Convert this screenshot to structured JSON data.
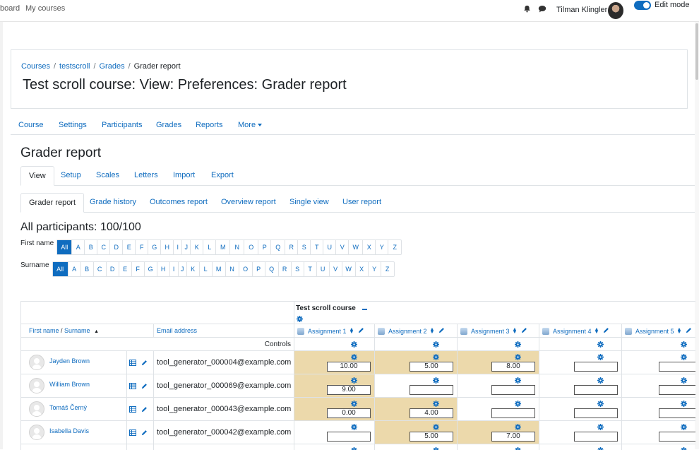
{
  "topbar": {
    "nav": [
      "board",
      "My courses"
    ],
    "user_name": "Tilman Klingler",
    "edit_mode_label": "Edit mode"
  },
  "breadcrumb": [
    "Courses",
    "testscroll",
    "Grades",
    "Grader report"
  ],
  "page_title": "Test scroll course: View: Preferences: Grader report",
  "course_nav": [
    "Course",
    "Settings",
    "Participants",
    "Grades",
    "Reports",
    "More"
  ],
  "main_heading": "Grader report",
  "tabs_primary": [
    "View",
    "Setup",
    "Scales",
    "Letters",
    "Import",
    "Export"
  ],
  "tabs_secondary": [
    "Grader report",
    "Grade history",
    "Outcomes report",
    "Overview report",
    "Single view",
    "User report"
  ],
  "participants_heading": "All participants: 100/100",
  "initials": {
    "firstname_label": "First name",
    "surname_label": "Surname",
    "all_label": "All",
    "letters": [
      "A",
      "B",
      "C",
      "D",
      "E",
      "F",
      "G",
      "H",
      "I",
      "J",
      "K",
      "L",
      "M",
      "N",
      "O",
      "P",
      "Q",
      "R",
      "S",
      "T",
      "U",
      "V",
      "W",
      "X",
      "Y",
      "Z"
    ]
  },
  "grader": {
    "course_name": "Test scroll course",
    "col_firstname": "First name",
    "col_slash": " / ",
    "col_surname": "Surname",
    "col_email": "Email address",
    "controls_label": "Controls",
    "assignments": [
      "Assignment 1",
      "Assignment 2",
      "Assignment 3",
      "Assignment 4",
      "Assignment 5"
    ],
    "rows": [
      {
        "name": "Jayden Brown",
        "email": "tool_generator_000004@example.com",
        "grades": [
          "10.00",
          "5.00",
          "8.00",
          "",
          ""
        ],
        "overridden": [
          true,
          true,
          true,
          false,
          false
        ]
      },
      {
        "name": "William Brown",
        "email": "tool_generator_000069@example.com",
        "grades": [
          "9.00",
          "",
          "",
          "",
          ""
        ],
        "overridden": [
          true,
          false,
          false,
          false,
          false
        ]
      },
      {
        "name": "Tomáš Černý",
        "email": "tool_generator_000043@example.com",
        "grades": [
          "0.00",
          "4.00",
          "",
          "",
          ""
        ],
        "overridden": [
          true,
          true,
          false,
          false,
          false
        ]
      },
      {
        "name": "Isabella Davis",
        "email": "tool_generator_000042@example.com",
        "grades": [
          "",
          "5.00",
          "7.00",
          "",
          ""
        ],
        "overridden": [
          false,
          true,
          true,
          false,
          false
        ]
      }
    ]
  },
  "colors": {
    "link": "#0f6cbf",
    "highlight": "#ecd9ab",
    "border": "#dee2e6"
  }
}
